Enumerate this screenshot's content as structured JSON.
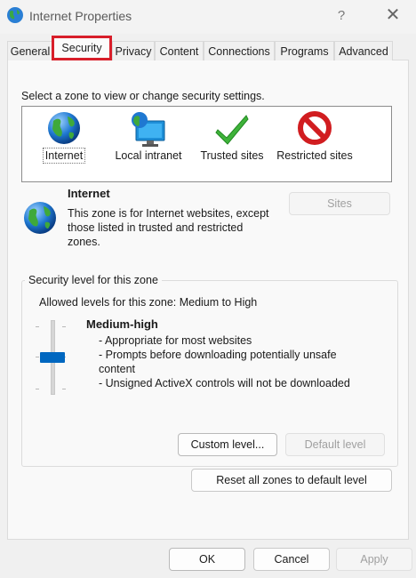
{
  "window": {
    "title": "Internet Properties",
    "help_glyph": "?",
    "close_glyph": "✕"
  },
  "tabs": [
    {
      "label": "General"
    },
    {
      "label": "Security",
      "active": true
    },
    {
      "label": "Privacy"
    },
    {
      "label": "Content"
    },
    {
      "label": "Connections"
    },
    {
      "label": "Programs"
    },
    {
      "label": "Advanced"
    }
  ],
  "security": {
    "zone_prompt": "Select a zone to view or change security settings.",
    "zones": [
      {
        "label": "Internet",
        "icon": "globe-icon",
        "selected": true
      },
      {
        "label": "Local intranet",
        "icon": "intranet-monitor-icon"
      },
      {
        "label": "Trusted sites",
        "icon": "checkmark-icon"
      },
      {
        "label": "Restricted sites",
        "icon": "no-entry-icon"
      }
    ],
    "selected_zone": {
      "name": "Internet",
      "description": "This zone is for Internet websites, except those listed in trusted and restricted zones."
    },
    "sites_label": "Sites",
    "level_group_label": "Security level for this zone",
    "allowed_levels": "Allowed levels for this zone: Medium to High",
    "level": {
      "name": "Medium-high",
      "bullets": [
        "- Appropriate for most websites",
        "- Prompts before downloading potentially unsafe content",
        "- Unsigned ActiveX controls will not be downloaded"
      ]
    },
    "custom_level_label": "Custom level...",
    "default_level_label": "Default level",
    "reset_all_label": "Reset all zones to default level"
  },
  "footer": {
    "ok_label": "OK",
    "cancel_label": "Cancel",
    "apply_label": "Apply"
  },
  "colors": {
    "active_tab_highlight": "#d81e2a",
    "slider_thumb": "#0067c0"
  }
}
